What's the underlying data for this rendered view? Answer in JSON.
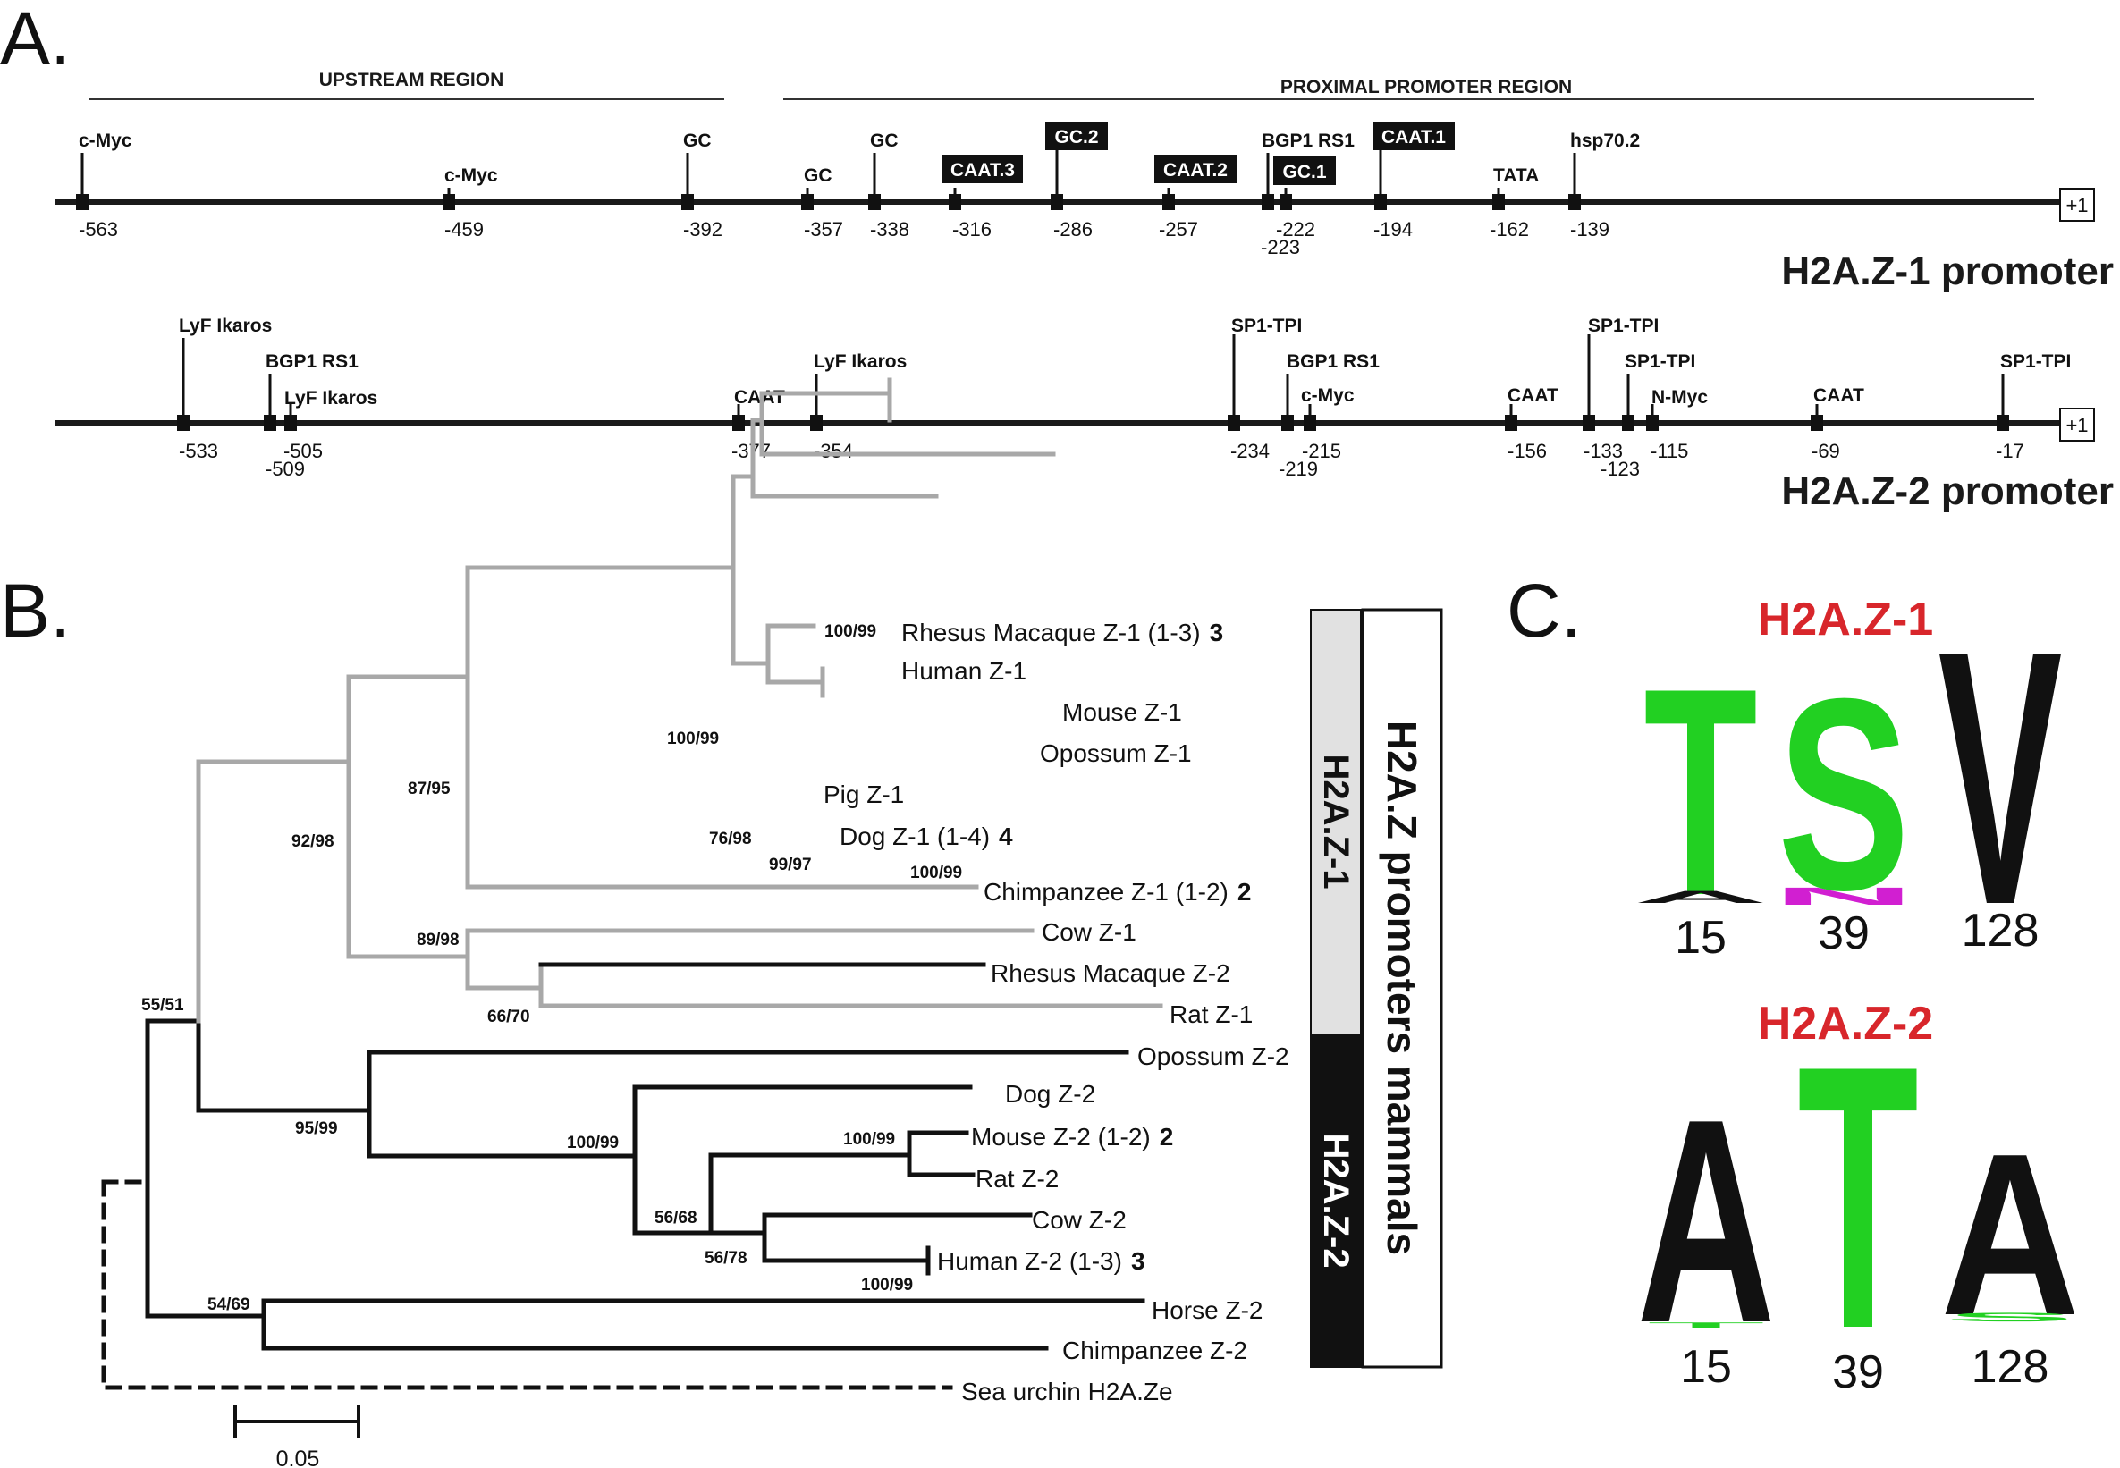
{
  "panels": {
    "a": "A.",
    "b": "B.",
    "c": "C."
  },
  "promoter_map": {
    "regions": [
      {
        "label": "UPSTREAM REGION"
      },
      {
        "label": "PROXIMAL PROMOTER REGION"
      }
    ],
    "start_label": "+1",
    "tracks": [
      {
        "name": "H2A.Z-1 promoter",
        "sites": [
          {
            "label": "c-Myc",
            "pos": -563,
            "pos_label": "-563"
          },
          {
            "label": "c-Myc",
            "pos": -459,
            "pos_label": "-459"
          },
          {
            "label": "GC",
            "pos": -392,
            "pos_label": "-392"
          },
          {
            "label": "GC",
            "pos": -357,
            "pos_label": "-357"
          },
          {
            "label": "GC",
            "pos": -338,
            "pos_label": "-338"
          },
          {
            "label": "CAAT.3",
            "pos": -316,
            "pos_label": "-316",
            "boxed": true
          },
          {
            "label": "GC.2",
            "pos": -286,
            "pos_label": "-286",
            "boxed": true
          },
          {
            "label": "CAAT.2",
            "pos": -257,
            "pos_label": "-257",
            "boxed": true
          },
          {
            "label": "BGP1 RS1",
            "pos": -223,
            "pos_label": "-223"
          },
          {
            "label": "GC.1",
            "pos": -222,
            "pos_label": "-222",
            "boxed": true
          },
          {
            "label": "CAAT.1",
            "pos": -194,
            "pos_label": "-194",
            "boxed": true
          },
          {
            "label": "TATA",
            "pos": -162,
            "pos_label": "-162"
          },
          {
            "label": "hsp70.2",
            "pos": -139,
            "pos_label": "-139"
          }
        ]
      },
      {
        "name": "H2A.Z-2 promoter",
        "sites": [
          {
            "label": "LyF Ikaros",
            "pos": -533,
            "pos_label": "-533"
          },
          {
            "label": "BGP1 RS1",
            "pos": -509,
            "pos_label": "-509"
          },
          {
            "label": "LyF Ikaros",
            "pos": -505,
            "pos_label": "-505"
          },
          {
            "label": "CAAT",
            "pos": -377,
            "pos_label": "-377"
          },
          {
            "label": "LyF Ikaros",
            "pos": -354,
            "pos_label": "-354"
          },
          {
            "label": "SP1-TPI",
            "pos": -234,
            "pos_label": "-234"
          },
          {
            "label": "BGP1 RS1",
            "pos": -219,
            "pos_label": "-219"
          },
          {
            "label": "c-Myc",
            "pos": -215,
            "pos_label": "-215"
          },
          {
            "label": "CAAT",
            "pos": -156,
            "pos_label": "-156"
          },
          {
            "label": "SP1-TPI",
            "pos": -133,
            "pos_label": "-133"
          },
          {
            "label": "SP1-TPI",
            "pos": -123,
            "pos_label": "-123"
          },
          {
            "label": "N-Myc",
            "pos": -115,
            "pos_label": "-115"
          },
          {
            "label": "CAAT",
            "pos": -69,
            "pos_label": "-69"
          },
          {
            "label": "SP1-TPI",
            "pos": -17,
            "pos_label": "-17"
          }
        ]
      }
    ]
  },
  "tree": {
    "leaves": [
      {
        "label": "Rhesus Macaque Z-1 (1-3)",
        "count": "3"
      },
      {
        "label": "Human Z-1",
        "count": ""
      },
      {
        "label": "Mouse Z-1",
        "count": ""
      },
      {
        "label": "Opossum Z-1",
        "count": ""
      },
      {
        "label": "Pig Z-1",
        "count": ""
      },
      {
        "label": "Dog Z-1 (1-4)",
        "count": "4"
      },
      {
        "label": "Chimpanzee Z-1 (1-2)",
        "count": "2"
      },
      {
        "label": "Cow Z-1",
        "count": ""
      },
      {
        "label": "Rhesus Macaque Z-2",
        "count": ""
      },
      {
        "label": "Rat Z-1",
        "count": ""
      },
      {
        "label": "Opossum Z-2",
        "count": ""
      },
      {
        "label": "Dog Z-2",
        "count": ""
      },
      {
        "label": "Mouse Z-2 (1-2)",
        "count": "2"
      },
      {
        "label": "Rat Z-2",
        "count": ""
      },
      {
        "label": "Cow Z-2",
        "count": ""
      },
      {
        "label": "Human Z-2 (1-3)",
        "count": "3"
      },
      {
        "label": "Horse Z-2",
        "count": ""
      },
      {
        "label": "Chimpanzee Z-2",
        "count": ""
      },
      {
        "label": "Sea urchin H2A.Ze",
        "count": ""
      }
    ],
    "support_values": [
      "100/99",
      "100/99",
      "87/95",
      "92/98",
      "76/98",
      "99/97",
      "100/99",
      "89/98",
      "66/70",
      "55/51",
      "95/99",
      "100/99",
      "100/99",
      "56/68",
      "56/78",
      "100/99",
      "54/69"
    ],
    "scale_bar": {
      "label": "0.05",
      "value": 0.05
    },
    "group_bar": {
      "title": "H2A.Z promoters mammals",
      "groups": [
        {
          "label": "H2A.Z-1",
          "fill": "#e1e1e1",
          "text_color": "#111111"
        },
        {
          "label": "H2A.Z-2",
          "fill": "#111111",
          "text_color": "#ffffff"
        }
      ]
    },
    "colors": {
      "z1_branch": "#a8a8a8",
      "z2_branch": "#111111"
    }
  },
  "sequence_logos": [
    {
      "title": "H2A.Z-1",
      "columns": [
        {
          "residue": "T",
          "position": "15",
          "color": "#22d022",
          "small": {
            "residue": "A",
            "color": "#111111"
          }
        },
        {
          "residue": "S",
          "position": "39",
          "color": "#22d022",
          "small": {
            "residue": "N",
            "color": "#d11fd1"
          }
        },
        {
          "residue": "V",
          "position": "128",
          "color": "#111111"
        }
      ]
    },
    {
      "title": "H2A.Z-2",
      "columns": [
        {
          "residue": "A",
          "position": "15",
          "color": "#111111",
          "small": {
            "residue": "T",
            "color": "#22d022"
          }
        },
        {
          "residue": "T",
          "position": "39",
          "color": "#22d022"
        },
        {
          "residue": "A",
          "position": "128",
          "color": "#111111",
          "small": {
            "residue": "S",
            "color": "#22d022"
          }
        }
      ]
    }
  ]
}
